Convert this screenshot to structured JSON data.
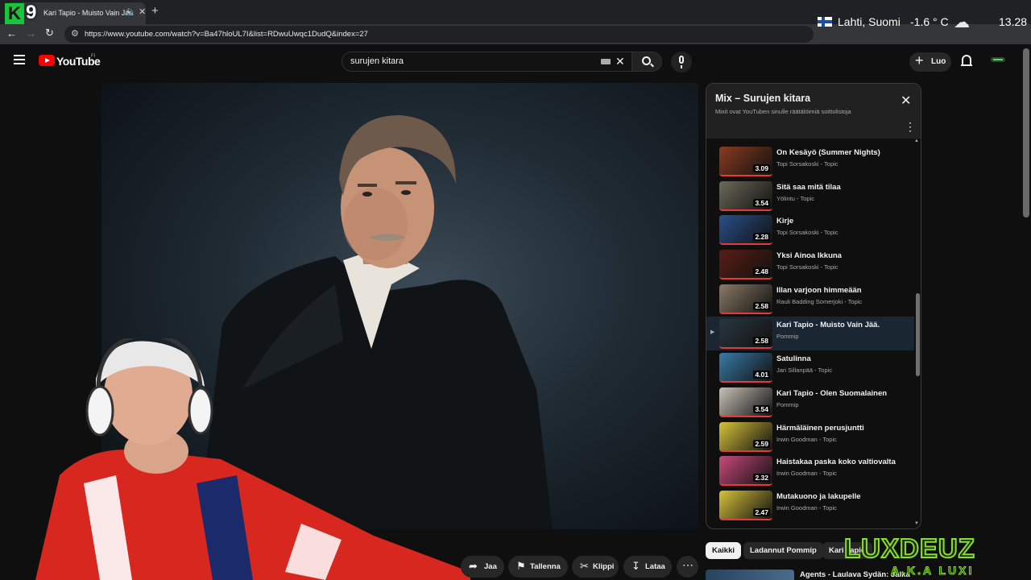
{
  "browser": {
    "tab_title": "Kari Tapio - Muisto Vain Jää",
    "url": "https://www.youtube.com/watch?v=Ba47hloUL7I&list=RDwuUwqc1DudQ&index=27",
    "overlay_logo_letter": "K",
    "overlay_logo_number": "9"
  },
  "weather": {
    "location": "Lahti, Suomi",
    "temperature": "-1.6 ° C",
    "time": "13.28"
  },
  "header": {
    "logo_text": "YouTube",
    "region": "FI",
    "search_value": "surujen kitara",
    "create_label": "Luo"
  },
  "playlist": {
    "title": "Mix – Surujen kitara",
    "subtitle": "Mixit ovat YouTuben sinulle räätälöimiä soittolistoja",
    "items": [
      {
        "title": "On Kesäyö (Summer Nights)",
        "channel": "Topi Sorsakoski - Topic",
        "duration": "3.09",
        "thumb": "#8a3b1e"
      },
      {
        "title": "Sitä saa mitä tilaa",
        "channel": "Yölintu - Topic",
        "duration": "3.54",
        "thumb": "#6d6a5a"
      },
      {
        "title": "Kirje",
        "channel": "Topi Sorsakoski - Topic",
        "duration": "2.28",
        "thumb": "#2b4f8a"
      },
      {
        "title": "Yksi Ainoa Ikkuna",
        "channel": "Topi Sorsakoski - Topic",
        "duration": "2.48",
        "thumb": "#5a1d14"
      },
      {
        "title": "Illan varjoon himmeään",
        "channel": "Rauli Badding Somerjoki - Topic",
        "duration": "2.58",
        "thumb": "#8a7a66"
      },
      {
        "title": "Kari Tapio - Muisto Vain Jää.",
        "channel": "Pommip",
        "duration": "2.58",
        "thumb": "#2a3642",
        "active": true
      },
      {
        "title": "Satulinna",
        "channel": "Jari Sillanpää - Topic",
        "duration": "4.01",
        "thumb": "#3a7aa8"
      },
      {
        "title": "Kari Tapio - Olen Suomalainen",
        "channel": "Pommip",
        "duration": "3.54",
        "thumb": "#c9c2b8"
      },
      {
        "title": "Härmäläinen perusjuntti",
        "channel": "Irwin Goodman - Topic",
        "duration": "2.59",
        "thumb": "#d8c23a"
      },
      {
        "title": "Haistakaa paska koko valtiovalta",
        "channel": "Irwin Goodman - Topic",
        "duration": "2.32",
        "thumb": "#c94a7a"
      },
      {
        "title": "Mutakuono ja lakupelle",
        "channel": "Irwin Goodman - Topic",
        "duration": "2.47",
        "thumb": "#d8c23a"
      }
    ]
  },
  "actions": {
    "share": "Jaa",
    "save": "Tallenna",
    "clip": "Klippi",
    "download": "Lataa"
  },
  "chips": [
    "Kaikki",
    "Ladannut Pommip",
    "Kari Tapio"
  ],
  "next_recommendation": "Agents - Laulava Sydän: Jalka",
  "watermark": {
    "main": "LUXDEUZ",
    "sub": "A.K.A LUXI"
  },
  "colors": {
    "accent_red": "#ff0000",
    "background": "#0f0f0f",
    "watermark_green": "#86e02a",
    "active_row": "#1a2631"
  }
}
